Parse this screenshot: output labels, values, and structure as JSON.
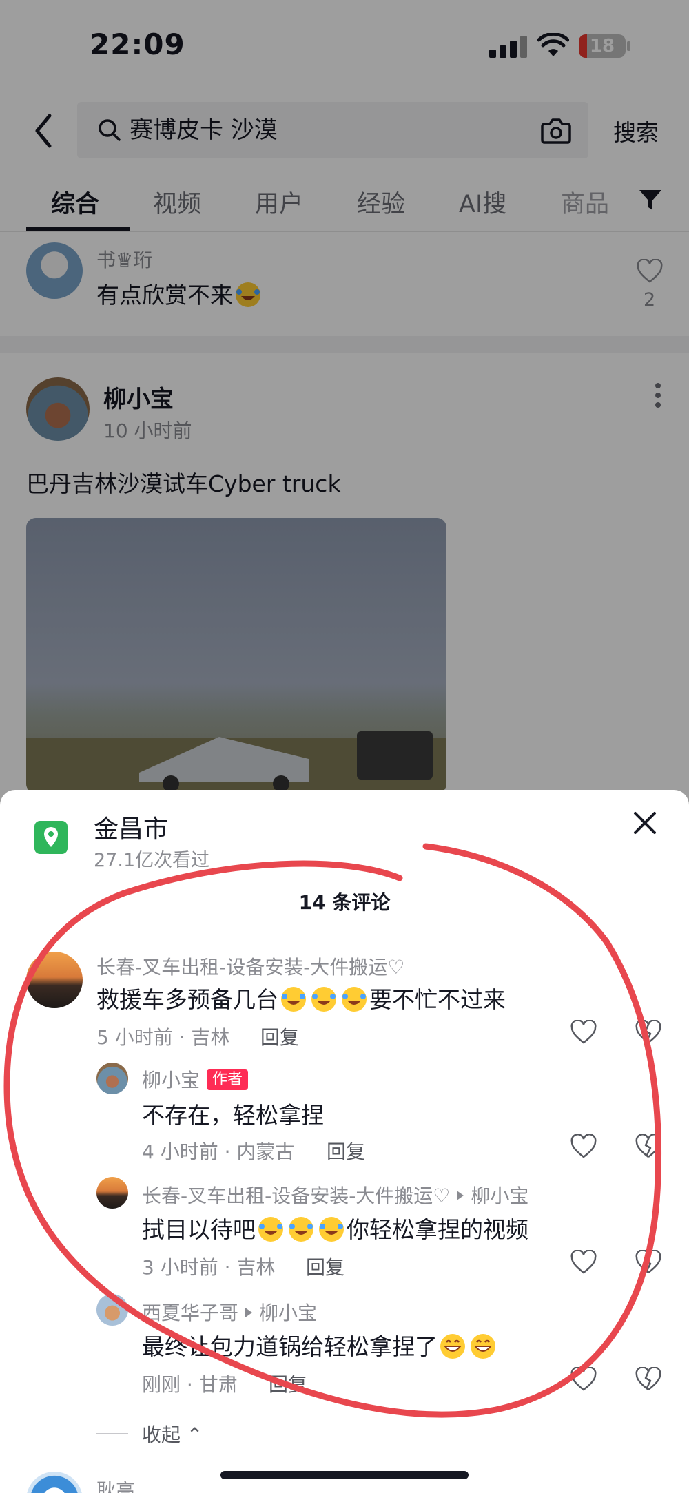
{
  "status_bar": {
    "time": "22:09",
    "battery": "18"
  },
  "search": {
    "query": "赛博皮卡 沙漠",
    "button_label": "搜索"
  },
  "tabs": [
    {
      "label": "综合",
      "active": true
    },
    {
      "label": "视频",
      "active": false
    },
    {
      "label": "用户",
      "active": false
    },
    {
      "label": "经验",
      "active": false
    },
    {
      "label": "AI搜",
      "active": false
    },
    {
      "label": "商品",
      "active": false
    }
  ],
  "top_comment": {
    "user": "书♛珩",
    "text": "有点欣赏不来",
    "likes": "2"
  },
  "post": {
    "author": "柳小宝",
    "time": "10 小时前",
    "caption": "巴丹吉林沙漠试车Cyber truck"
  },
  "sheet": {
    "location": "金昌市",
    "views": "27.1亿次看过",
    "comment_count": "14 条评论",
    "comments": [
      {
        "user": "长春-叉车出租-设备安装-大件搬运♡",
        "text_before": "救援车多预备几台",
        "text_after": "要不忙不过来",
        "meta": "5 小时前 · 吉林",
        "reply": "回复"
      },
      {
        "user": "柳小宝",
        "badge": "作者",
        "text": "不存在，轻松拿捏",
        "meta": "4 小时前 · 内蒙古",
        "reply": "回复"
      },
      {
        "user": "长春-叉车出租-设备安装-大件搬运♡",
        "reply_to": "柳小宝",
        "text_before": "拭目以待吧",
        "text_after": "你轻松拿捏的视频",
        "meta": "3 小时前 · 吉林",
        "reply": "回复"
      },
      {
        "user": "西夏华子哥",
        "reply_to": "柳小宝",
        "text_before": "最终让包力道锅给轻松拿捏了",
        "meta": "刚刚 · 甘肃",
        "reply": "回复"
      }
    ],
    "collapse_label": "收起",
    "next_user": "耿高"
  },
  "colors": {
    "accent": "#fe2c55",
    "location_green": "#2fb65b",
    "annotation_red": "#e8474e"
  }
}
